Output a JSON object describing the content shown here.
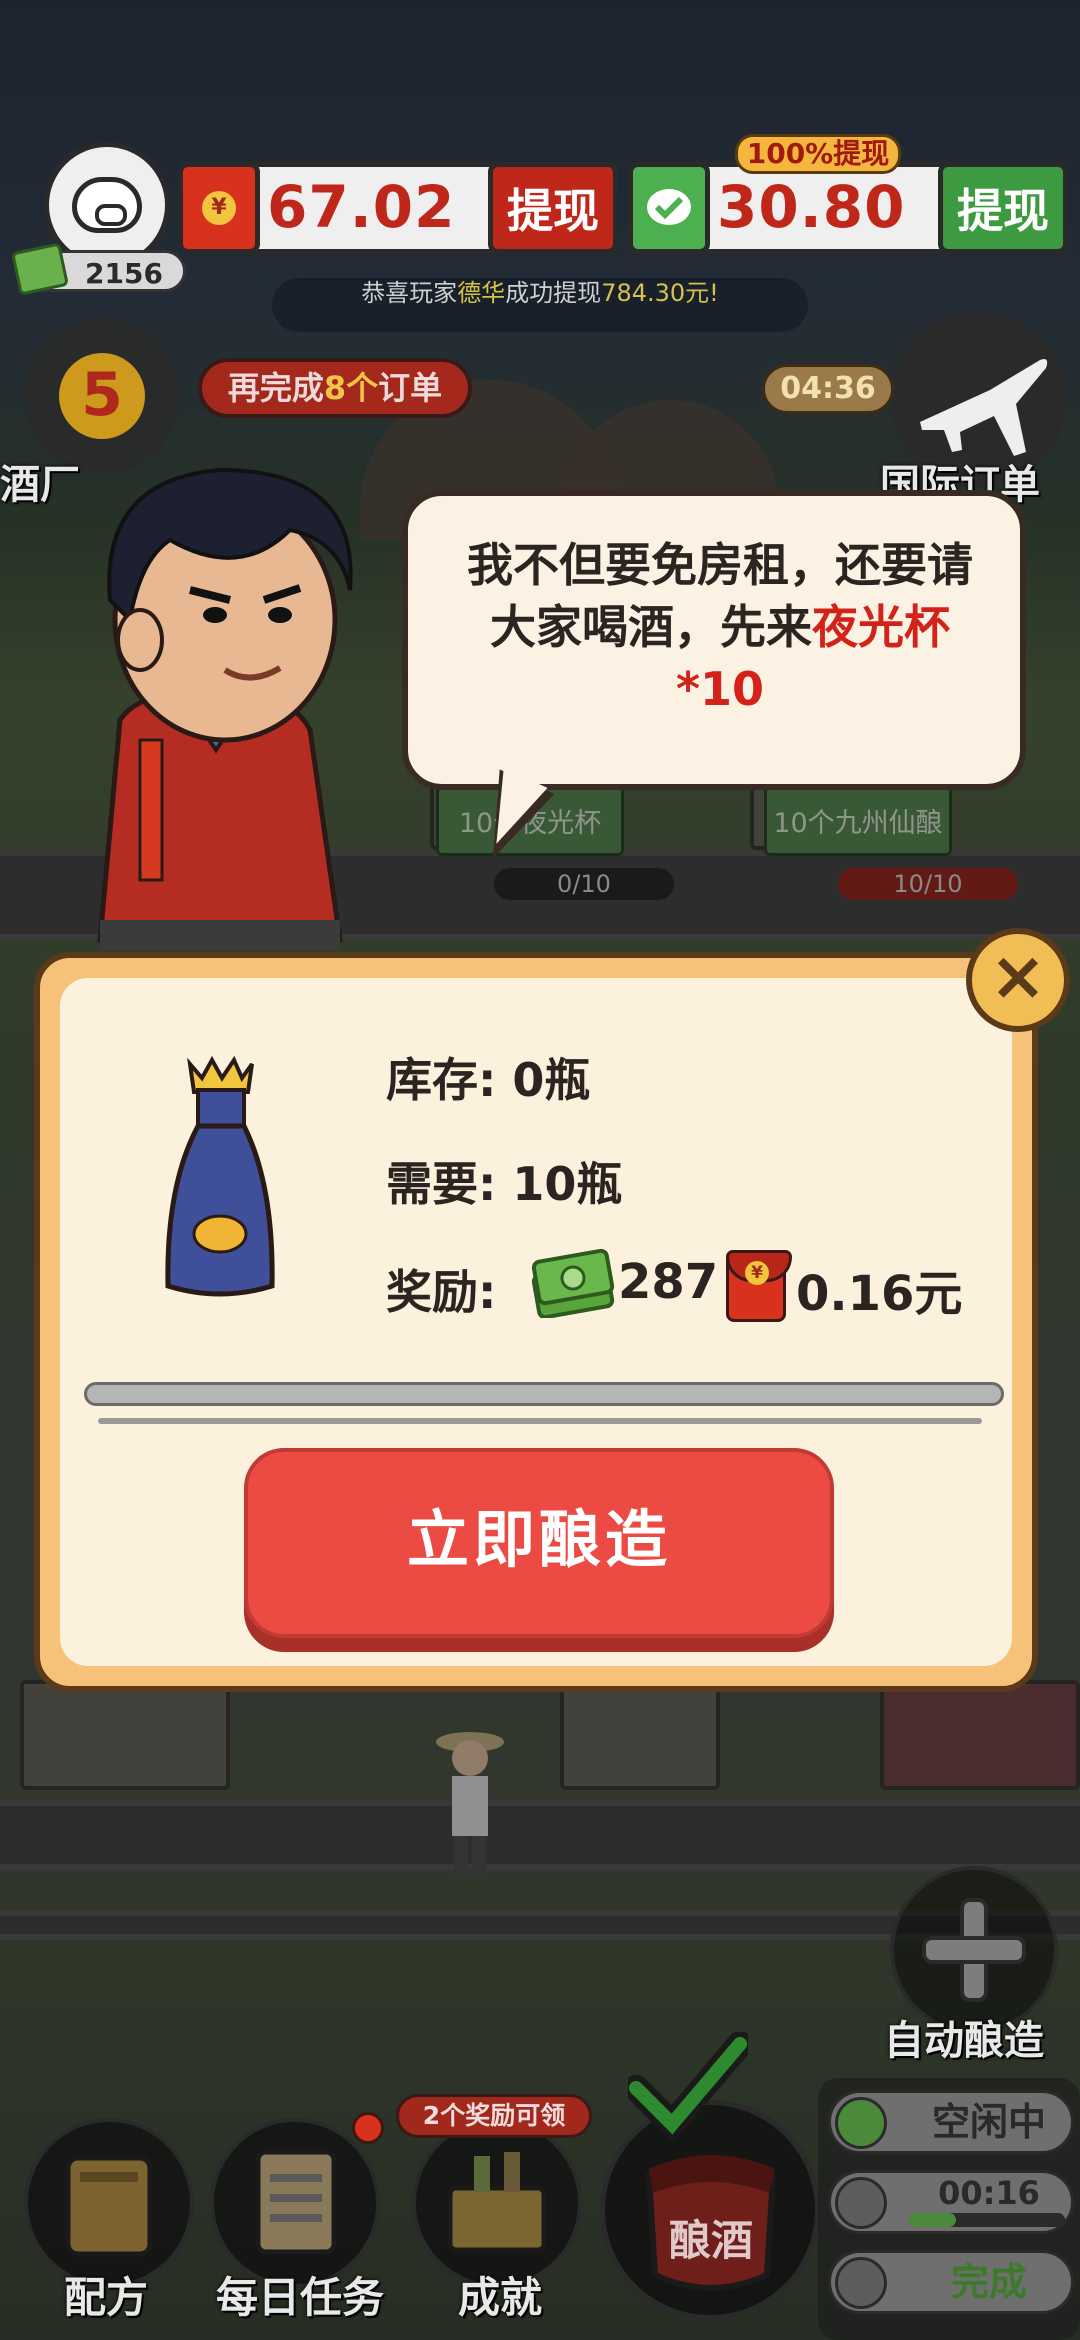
{
  "hud": {
    "cash_count": "2156",
    "redpacket_balance": "67.02",
    "redpacket_withdraw": "提现",
    "wechat_balance": "30.80",
    "wechat_withdraw": "提现",
    "wechat_badge": "100%提现",
    "ticker_prefix": "恭喜玩家",
    "ticker_name": "德华",
    "ticker_mid": "成功提现",
    "ticker_amount": "784.30元!"
  },
  "level": {
    "value": "5",
    "label": "酒厂",
    "orders_prefix": "再完成",
    "orders_count": "8个",
    "orders_suffix": "订单"
  },
  "intl": {
    "timer": "04:36",
    "label": "国际订单"
  },
  "scene_orders": [
    {
      "name": "10个夜光杯",
      "progress": "0/10",
      "full": false
    },
    {
      "name": "10个九州仙酿",
      "progress": "10/10",
      "full": true
    }
  ],
  "speech": {
    "line1": "我不但要免房租，还要请",
    "line2_a": "大家喝酒，先来",
    "line2_b": "夜光杯",
    "line3": "*10"
  },
  "dialog": {
    "close": "×",
    "stock_label": "库存: ",
    "stock_value": "0瓶",
    "need_label": "需要: ",
    "need_value": "10瓶",
    "reward_label": "奖励: ",
    "reward_cash": "287",
    "reward_money": "0.16元",
    "progress": 0,
    "brew_button": "立即酿造"
  },
  "bottom": {
    "auto_brew": "自动酿造",
    "recipe": "配方",
    "daily_tasks": "每日任务",
    "achievements": "成就",
    "reward_tip": "2个奖励可领",
    "brew": "酿酒",
    "status_idle": "空闲中",
    "status_timer": "00:16",
    "status_done": "完成"
  },
  "colors": {
    "accent_red": "#ec4b44",
    "money_red": "#c0271b",
    "wechat_green": "#4caf50",
    "panel_cream": "#fcf1dd"
  }
}
